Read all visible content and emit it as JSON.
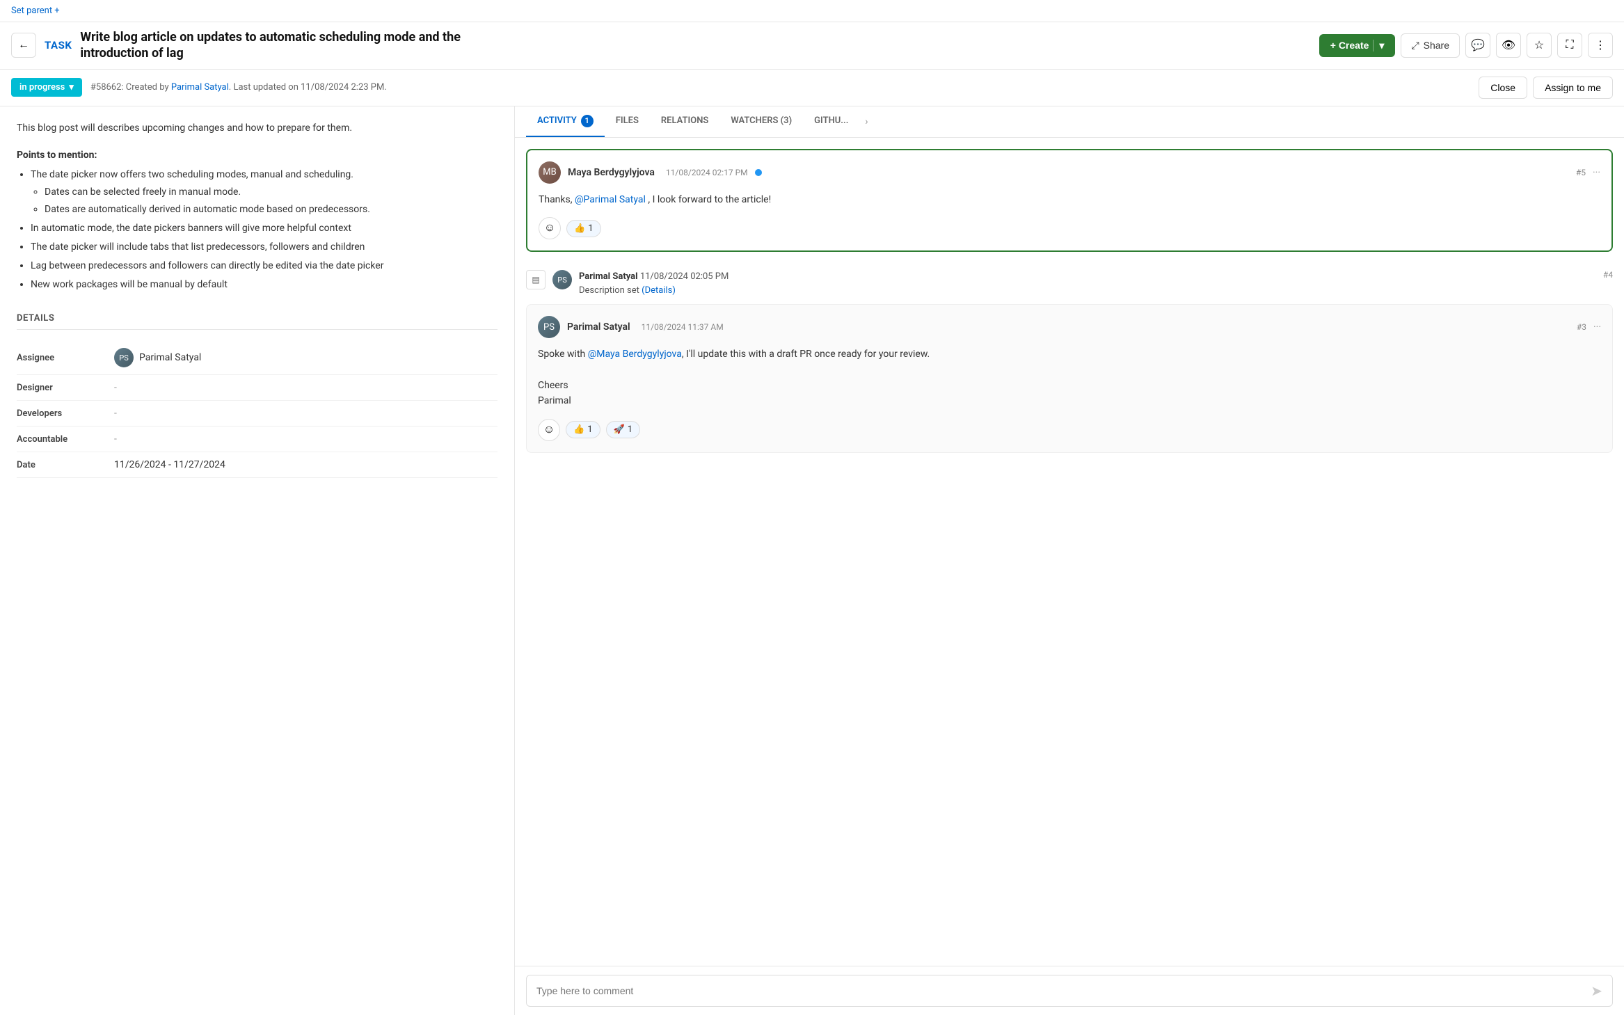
{
  "topbar": {
    "set_parent": "Set parent +"
  },
  "header": {
    "back_btn": "←",
    "task_badge": "TASK",
    "title": "Write blog article on updates to automatic scheduling mode and the introduction of lag",
    "create_btn": "+ Create",
    "share_btn": "Share",
    "icons": [
      "💬",
      "👁",
      "⭐",
      "⛶",
      "⋮"
    ]
  },
  "status_bar": {
    "status": "in progress",
    "meta_prefix": "#58662: Created by ",
    "author": "Parimal Satyal",
    "meta_suffix": ". Last updated on 11/08/2024 2:23 PM.",
    "close_btn": "Close",
    "assign_btn": "Assign to me"
  },
  "description": {
    "intro": "This blog post will describes upcoming changes and how to prepare for them.",
    "points_title": "Points to mention:",
    "bullets": [
      {
        "text": "The date picker now offers two scheduling modes, manual and scheduling.",
        "sub": [
          "Dates can be selected freely in manual mode.",
          "Dates are automatically derived in automatic mode based on predecessors."
        ]
      },
      {
        "text": "In automatic mode, the date pickers banners will give more helpful context",
        "sub": []
      },
      {
        "text": "The date picker will include tabs that list predecessors, followers and children",
        "sub": []
      },
      {
        "text": "Lag between predecessors and followers can directly be edited via the date picker",
        "sub": []
      },
      {
        "text": "New work packages will be manual by default",
        "sub": []
      }
    ]
  },
  "details": {
    "title": "DETAILS",
    "rows": [
      {
        "label": "Assignee",
        "value": "Parimal Satyal",
        "type": "user"
      },
      {
        "label": "Designer",
        "value": "-",
        "type": "empty"
      },
      {
        "label": "Developers",
        "value": "-",
        "type": "empty"
      },
      {
        "label": "Accountable",
        "value": "-",
        "type": "empty"
      },
      {
        "label": "Date",
        "value": "11/26/2024 - 11/27/2024",
        "type": "text"
      }
    ]
  },
  "tabs": [
    {
      "label": "ACTIVITY",
      "badge": "1",
      "active": true
    },
    {
      "label": "FILES",
      "badge": null,
      "active": false
    },
    {
      "label": "RELATIONS",
      "badge": null,
      "active": false
    },
    {
      "label": "WATCHERS (3)",
      "badge": null,
      "active": false
    },
    {
      "label": "GITHU...",
      "badge": null,
      "active": false
    }
  ],
  "comments": [
    {
      "id": "comment-maya",
      "author": "Maya Berdygylyjova",
      "time": "11/08/2024 02:17 PM",
      "num": "#5",
      "body": "Thanks, @Parimal Satyal , I look forward to the article!",
      "reactions": [
        {
          "emoji": "👍",
          "count": "1"
        }
      ],
      "highlighted": true,
      "dot": true
    },
    {
      "id": "activity-parimal-4",
      "author": "Parimal Satyal",
      "time": "11/08/2024 02:05 PM",
      "num": "#4",
      "type": "activity",
      "body": "Description set (Details)"
    },
    {
      "id": "comment-parimal-3",
      "author": "Parimal Satyal",
      "time": "11/08/2024 11:37 AM",
      "num": "#3",
      "body": "Spoke with @Maya Berdygylyjova, I'll update this with a draft PR once ready for your review.\n\nCheers\nParimal",
      "reactions": [
        {
          "emoji": "👍",
          "count": "1"
        },
        {
          "emoji": "🚀",
          "count": "1"
        }
      ],
      "highlighted": false,
      "dot": false
    }
  ],
  "comment_input": {
    "placeholder": "Type here to comment"
  }
}
